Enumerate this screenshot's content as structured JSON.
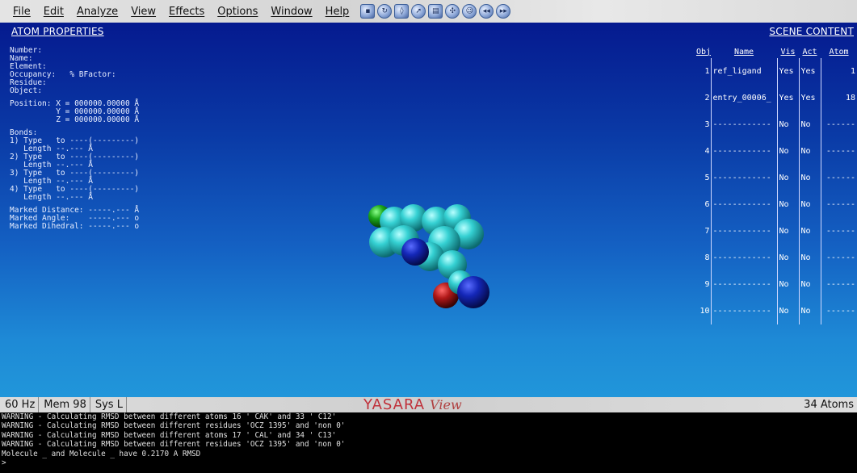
{
  "menubar": {
    "items": [
      "File",
      "Edit",
      "Analyze",
      "View",
      "Effects",
      "Options",
      "Window",
      "Help"
    ]
  },
  "toolbar": {
    "icons": [
      "save-icon",
      "refresh-icon",
      "rotate-icon",
      "cursor-icon",
      "clipboard-icon",
      "settings-icon",
      "face-icon",
      "rewind-icon",
      "play-icon"
    ]
  },
  "atom_properties": {
    "title": "ATOM PROPERTIES",
    "lines": [
      "Number:",
      "Name:",
      "Element:",
      "Occupancy:   % BFactor:",
      "Residue:",
      "Object:",
      "",
      "Position: X = 000000.00000 Å",
      "          Y = 000000.00000 Å",
      "          Z = 000000.00000 Å",
      "",
      "Bonds:",
      "1) Type   to ----(---------)",
      "   Length --.--- Å",
      "2) Type   to ----(---------)",
      "   Length --.--- Å",
      "3) Type   to ----(---------)",
      "   Length --.--- Å",
      "4) Type   to ----(---------)",
      "   Length --.--- Å",
      "",
      "Marked Distance: -----.--- Å",
      "Marked Angle:    -----.--- o",
      "Marked Dihedral: -----.--- o"
    ]
  },
  "scene_content": {
    "title": "SCENE CONTENT",
    "headers": [
      "Obj",
      "Name",
      "Vis",
      "Act",
      "Atom"
    ],
    "rows": [
      {
        "obj": "1",
        "name": "ref_ligand",
        "vis": "Yes",
        "act": "Yes",
        "atom": "1"
      },
      {
        "obj": "2",
        "name": "entry_00006_",
        "vis": "Yes",
        "act": "Yes",
        "atom": "18"
      },
      {
        "obj": "3",
        "name": "------------",
        "vis": "No",
        "act": "No",
        "atom": "------"
      },
      {
        "obj": "4",
        "name": "------------",
        "vis": "No",
        "act": "No",
        "atom": "------"
      },
      {
        "obj": "5",
        "name": "------------",
        "vis": "No",
        "act": "No",
        "atom": "------"
      },
      {
        "obj": "6",
        "name": "------------",
        "vis": "No",
        "act": "No",
        "atom": "------"
      },
      {
        "obj": "7",
        "name": "------------",
        "vis": "No",
        "act": "No",
        "atom": "------"
      },
      {
        "obj": "8",
        "name": "------------",
        "vis": "No",
        "act": "No",
        "atom": "------"
      },
      {
        "obj": "9",
        "name": "------------",
        "vis": "No",
        "act": "No",
        "atom": "------"
      },
      {
        "obj": "10",
        "name": "------------",
        "vis": "No",
        "act": "No",
        "atom": "------"
      }
    ]
  },
  "statusbar": {
    "hz": "60  Hz",
    "mem": "Mem 98",
    "sys": "Sys L",
    "logo_main": "YASARA",
    "logo_sub": "View",
    "atoms": "34 Atoms"
  },
  "console": {
    "lines": [
      "WARNING - Calculating RMSD between different atoms 16 ' CAK' and 33 ' C12'",
      "WARNING - Calculating RMSD between different residues 'OCZ 1395' and 'non 0'",
      "WARNING - Calculating RMSD between different atoms 17 ' CAL' and 34 ' C13'",
      "WARNING - Calculating RMSD between different residues 'OCZ 1395' and 'non 0'",
      "Molecule _ and Molecule _ have 0.2170 A RMSD",
      ">"
    ]
  },
  "colors": {
    "viewport_top": "#051a8f",
    "viewport_bottom": "#2196da",
    "carbon": "#2fc6c9",
    "nitrogen": "#1021b8",
    "oxygen": "#b81818",
    "chlorine": "#1aa61a"
  }
}
